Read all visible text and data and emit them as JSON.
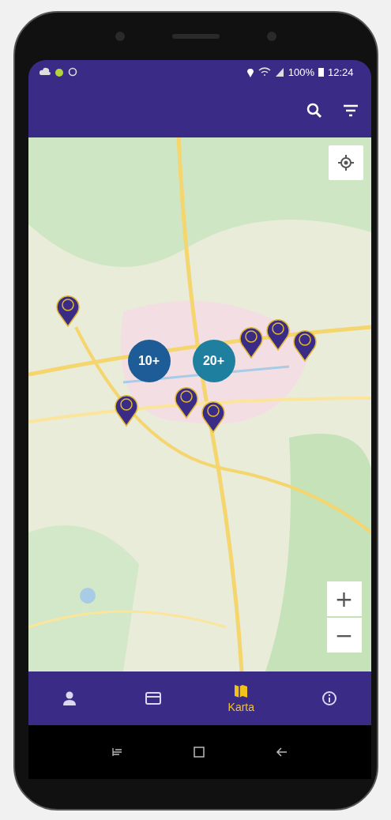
{
  "status_bar": {
    "battery": "100%",
    "time": "12:24"
  },
  "map": {
    "clusters": [
      {
        "label": "10+",
        "color": "#1d5c96"
      },
      {
        "label": "20+",
        "color": "#1f7f9f"
      }
    ],
    "zoom_in": "+",
    "zoom_out": "−"
  },
  "nav": [
    {
      "selected": false
    },
    {
      "selected": false
    },
    {
      "selected": true,
      "label": "Karta"
    },
    {
      "selected": false
    }
  ]
}
